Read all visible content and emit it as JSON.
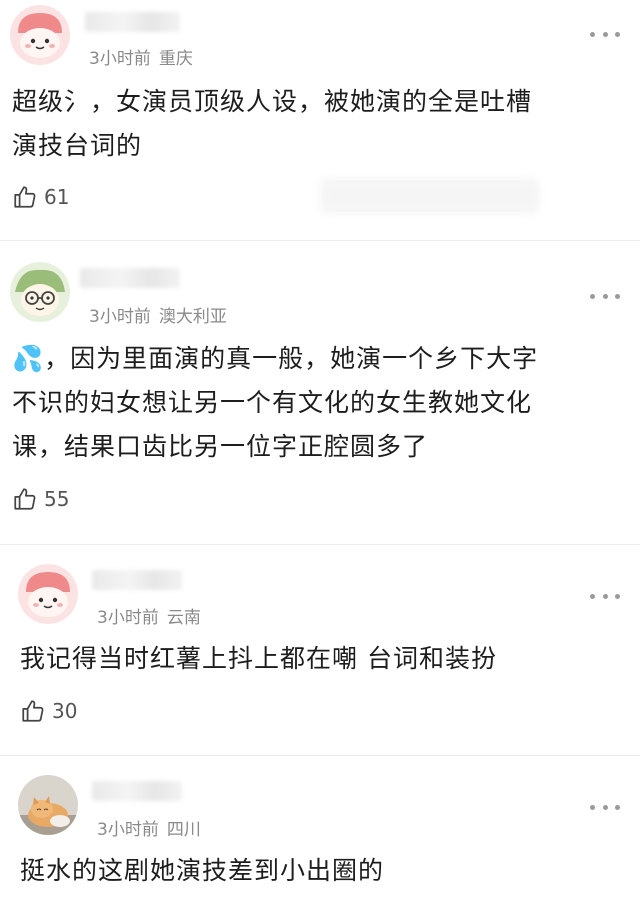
{
  "comments": [
    {
      "time": "3小时前",
      "location": "重庆",
      "text_lines": [
        "超级氵，女演员顶级人设，被她演的全是吐槽",
        "演技台词的"
      ],
      "likes": "61"
    },
    {
      "time": "3小时前",
      "location": "澳大利亚",
      "text_lines": [
        "💦，因为里面演的真一般，她演一个乡下大字",
        "不识的妇女想让另一个有文化的女生教她文化",
        "课，结果口齿比另一位字正腔圆多了"
      ],
      "likes": "55"
    },
    {
      "time": "3小时前",
      "location": "云南",
      "text_lines": [
        "我记得当时红薯上抖上都在嘲 台词和装扮"
      ],
      "likes": "30"
    },
    {
      "time": "3小时前",
      "location": "四川",
      "text_lines": [
        "挺水的这剧她演技差到小出圈的"
      ],
      "likes": ""
    }
  ],
  "icons": {
    "like": "thumbs-up-icon",
    "more": "more-dots-icon"
  },
  "colors": {
    "meta": "#8a8a8a",
    "text": "#1d1d1d",
    "divider": "#ececec"
  }
}
